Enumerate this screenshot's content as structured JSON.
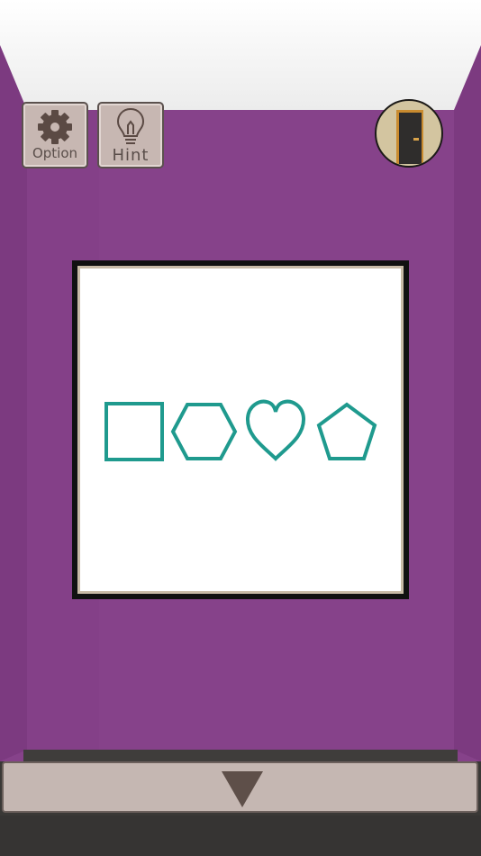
{
  "toolbar": {
    "option_label": "Option",
    "hint_label": "Hint"
  },
  "icons": {
    "option": "gear-icon",
    "hint": "lightbulb-icon",
    "exit": "door-icon",
    "back": "down-triangle-icon"
  },
  "puzzle": {
    "shapes": [
      "square",
      "hexagon",
      "heart",
      "pentagon"
    ],
    "shape_color": "#1f9a8e"
  },
  "colors": {
    "wall": "#86428a",
    "ceiling": "#f4f4f4",
    "button_bg": "#c7b7b2",
    "frame": "#111111"
  }
}
